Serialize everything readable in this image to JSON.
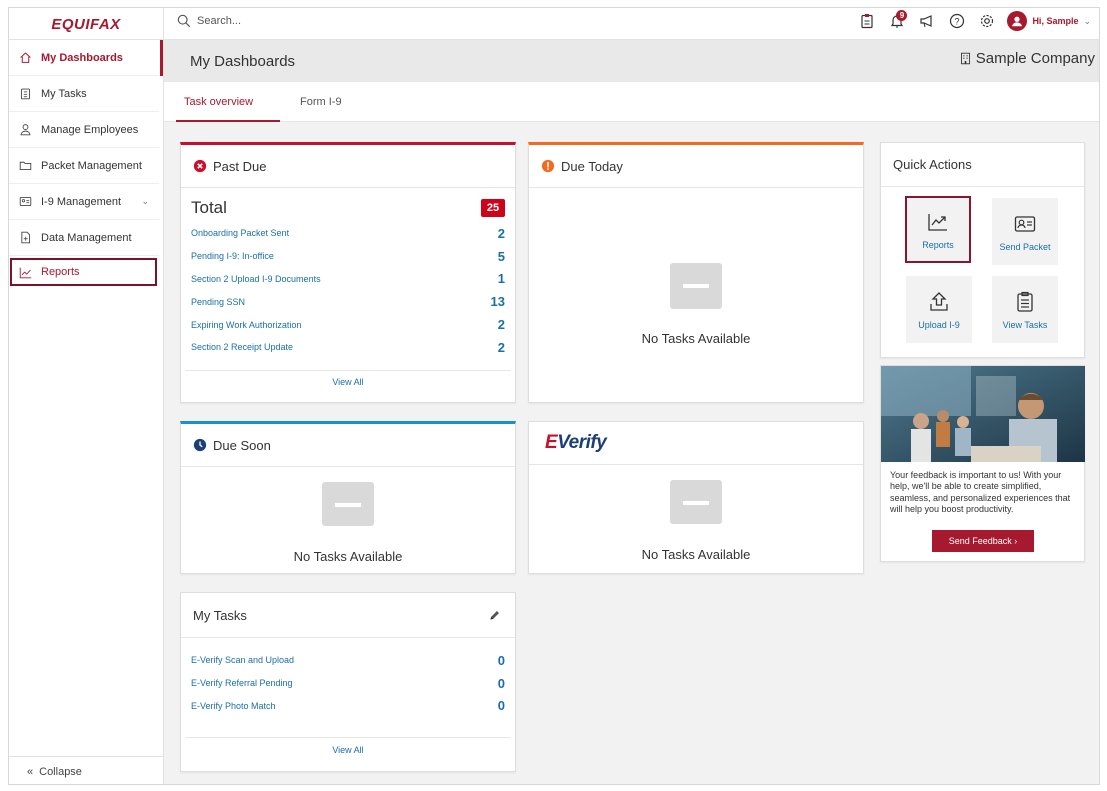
{
  "brand": {
    "logo_text": "EQUIFAX"
  },
  "search": {
    "placeholder": "Search..."
  },
  "topbar": {
    "notification_count": "9",
    "user_greeting": "Hi, Sample"
  },
  "sidebar": {
    "items": [
      {
        "label": "My Dashboards",
        "icon": "home-icon"
      },
      {
        "label": "My Tasks",
        "icon": "clipboard-icon"
      },
      {
        "label": "Manage Employees",
        "icon": "person-icon"
      },
      {
        "label": "Packet Management",
        "icon": "folder-icon"
      },
      {
        "label": "I-9 Management",
        "icon": "id-card-icon"
      },
      {
        "label": "Data Management",
        "icon": "document-icon"
      },
      {
        "label": "Reports",
        "icon": "chart-icon"
      }
    ],
    "collapse_label": "Collapse"
  },
  "header": {
    "title": "My Dashboards",
    "company": "Sample Company"
  },
  "tabs": [
    {
      "label": "Task overview"
    },
    {
      "label": "Form I-9"
    }
  ],
  "past_due": {
    "title": "Past Due",
    "total_label": "Total",
    "total_count": "25",
    "rows": [
      {
        "label": "Onboarding Packet Sent",
        "count": "2"
      },
      {
        "label": "Pending I-9: In-office",
        "count": "5"
      },
      {
        "label": "Section 2 Upload I-9 Documents",
        "count": "1"
      },
      {
        "label": "Pending SSN",
        "count": "13"
      },
      {
        "label": "Expiring Work Authorization",
        "count": "2"
      },
      {
        "label": "Section 2 Receipt Update",
        "count": "2"
      }
    ],
    "view_all": "View All"
  },
  "due_today": {
    "title": "Due Today",
    "empty": "No Tasks Available"
  },
  "due_soon": {
    "title": "Due Soon",
    "empty": "No Tasks Available"
  },
  "everify": {
    "logo": "Verify",
    "logo_prefix": "E",
    "empty": "No Tasks Available"
  },
  "my_tasks": {
    "title": "My Tasks",
    "rows": [
      {
        "label": "E-Verify Scan and Upload",
        "count": "0"
      },
      {
        "label": "E-Verify Referral Pending",
        "count": "0"
      },
      {
        "label": "E-Verify Photo Match",
        "count": "0"
      }
    ],
    "view_all": "View All"
  },
  "quick_actions": {
    "title": "Quick Actions",
    "buttons": [
      {
        "label": "Reports",
        "icon": "chart-icon"
      },
      {
        "label": "Send Packet",
        "icon": "id-card-icon"
      },
      {
        "label": "Upload I-9",
        "icon": "upload-icon"
      },
      {
        "label": "View Tasks",
        "icon": "clipboard-icon"
      }
    ]
  },
  "promo": {
    "text": "Your feedback is important to us! With your help, we'll be able to create simplified, seamless, and personalized experiences that will help you boost productivity.",
    "button": "Send Feedback ›"
  },
  "colors": {
    "brand": "#a6192e",
    "link": "#1a6fa8",
    "past_due": "#c8102e",
    "due_today": "#f36b21",
    "due_soon": "#1a91c9"
  }
}
